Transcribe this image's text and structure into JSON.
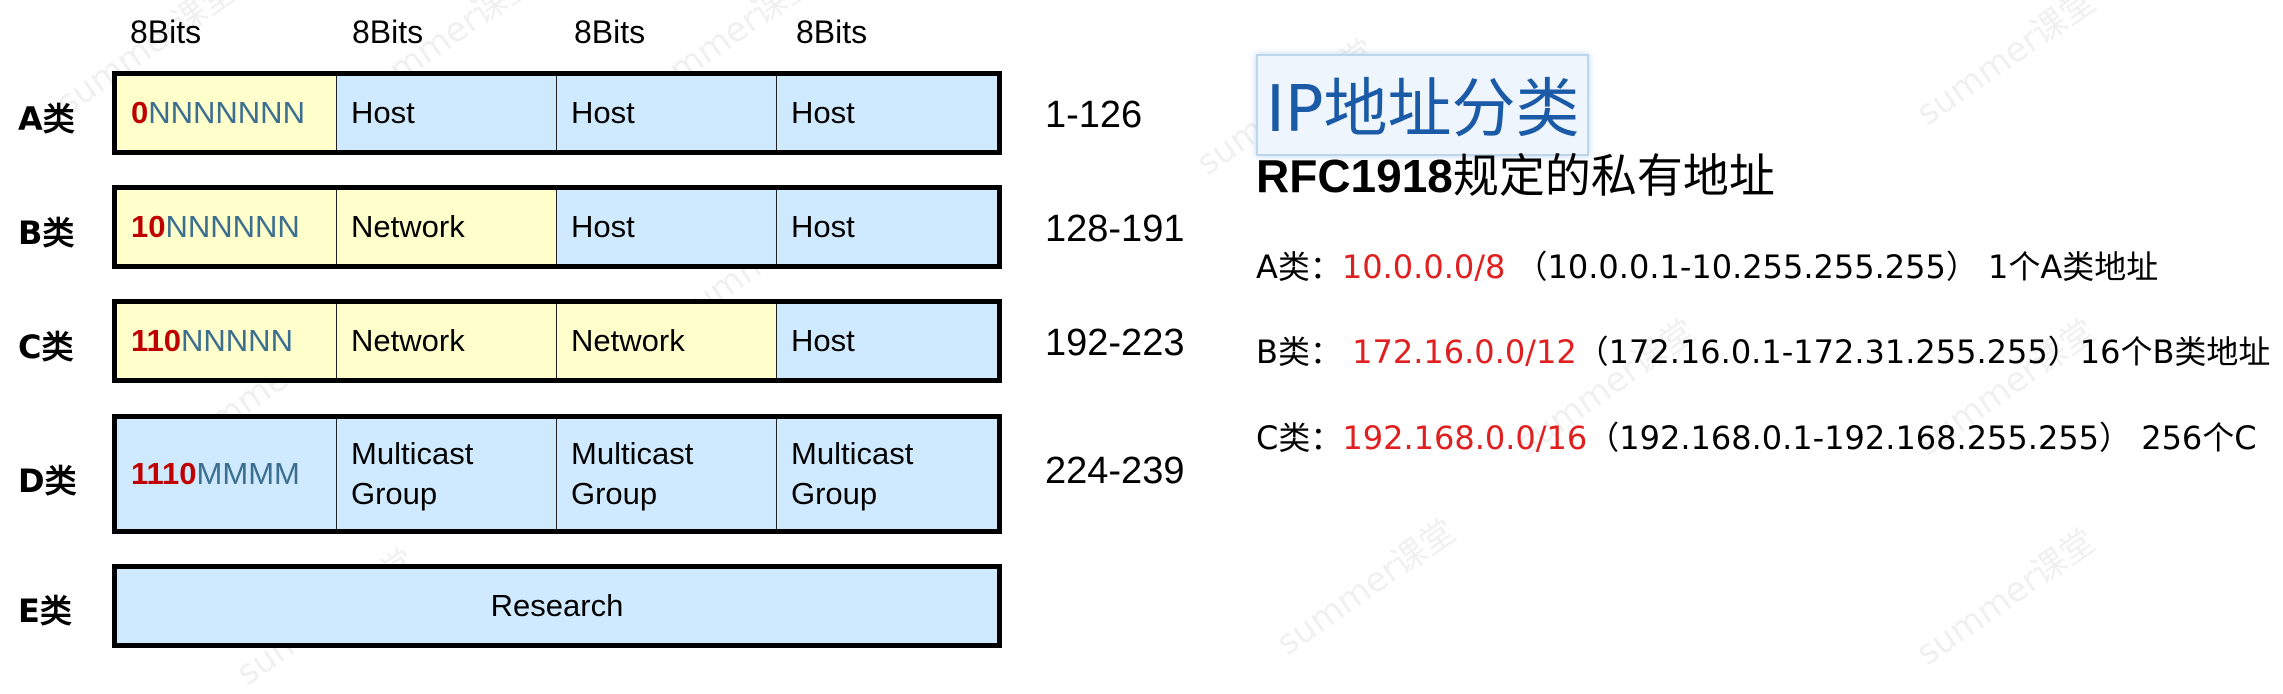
{
  "bits_header": [
    "8Bits",
    "8Bits",
    "8Bits",
    "8Bits"
  ],
  "classes": {
    "a": {
      "label": "A类",
      "prefix": "0",
      "prefix_rest": "NNNNNNN",
      "cells": [
        "Host",
        "Host",
        "Host"
      ],
      "range": "1-126"
    },
    "b": {
      "label": "B类",
      "prefix": "10",
      "prefix_rest": "NNNNNN",
      "cells": [
        "Network",
        "Host",
        "Host"
      ],
      "range": "128-191"
    },
    "c": {
      "label": "C类",
      "prefix": "110",
      "prefix_rest": "NNNNN",
      "cells": [
        "Network",
        "Network",
        "Host"
      ],
      "range": "192-223"
    },
    "d": {
      "label": "D类",
      "prefix": "1110",
      "prefix_rest": "MMMM",
      "cells": [
        {
          "line1": "Multicast",
          "line2": "Group"
        },
        {
          "line1": "Multicast",
          "line2": "Group"
        },
        {
          "line1": "Multicast",
          "line2": "Group"
        }
      ],
      "range": "224-239"
    },
    "e": {
      "label": "E类",
      "content": "Research"
    }
  },
  "right_panel": {
    "title": "IP地址分类",
    "subtitle_bold": "RFC1918",
    "subtitle_rest": "规定的私有地址",
    "lines": [
      {
        "prefix": "A类：",
        "cidr": "10.0.0.0/8",
        "range": " （10.0.0.1-10.255.255.255） ",
        "suffix": "1个A类地址"
      },
      {
        "prefix": "B类： ",
        "cidr": "172.16.0.0/12",
        "range": "（172.16.0.1-172.31.255.255）",
        "suffix": "16个B类地址"
      },
      {
        "prefix": "C类：",
        "cidr": "192.168.0.0/16",
        "range": "（192.168.0.1-192.168.255.255） ",
        "suffix": "256个C"
      }
    ]
  },
  "colors": {
    "network_cell": "#ffffcc",
    "host_cell": "#cfe9ff",
    "prefix_bits": "#c00000",
    "cidr_text": "#e02020",
    "title_text": "#1a5aa6"
  }
}
